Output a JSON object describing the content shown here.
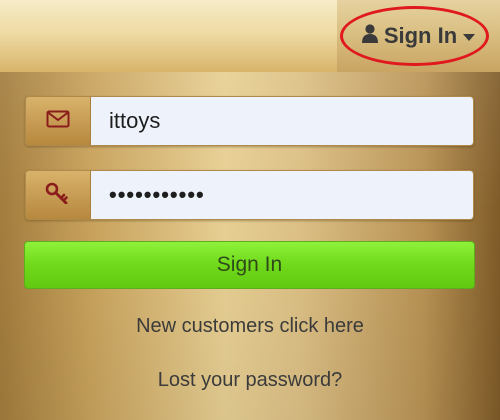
{
  "header": {
    "signin_label": "Sign In",
    "user_icon": "user-icon",
    "caret_icon": "caret-down-icon",
    "annotation_color": "#e0191e"
  },
  "form": {
    "username": {
      "icon": "envelope-icon",
      "value": "ittoys"
    },
    "password": {
      "icon": "key-icon",
      "value": "•••••••••••"
    },
    "submit_label": "Sign In",
    "submit_color": "#6fd91a"
  },
  "links": {
    "new_customers": "New customers click here",
    "lost_password": "Lost your password?"
  }
}
